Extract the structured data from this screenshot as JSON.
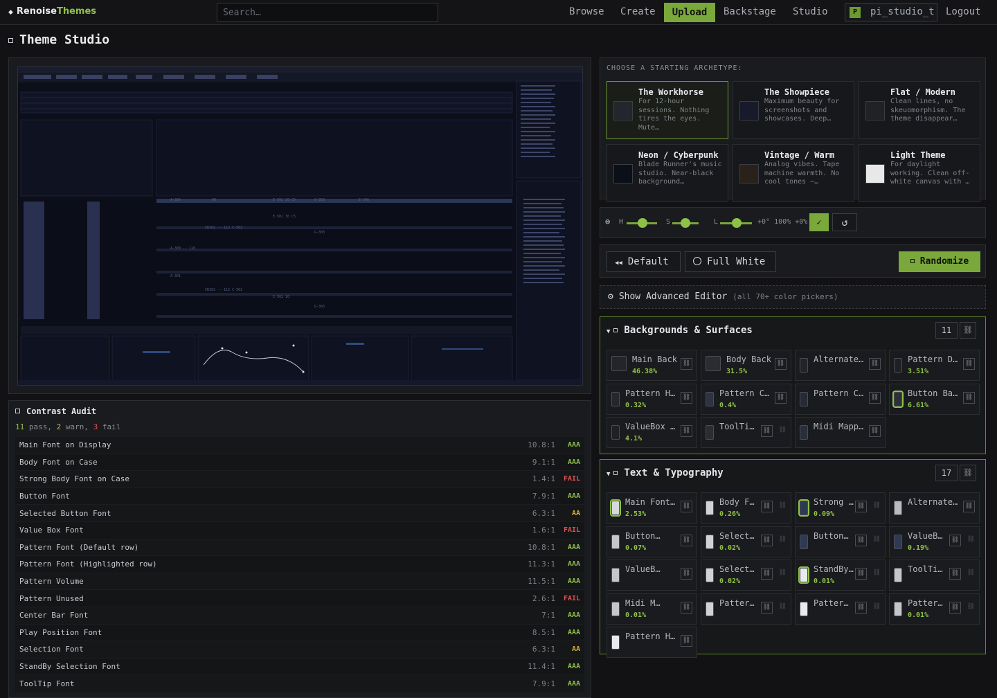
{
  "app": {
    "brand_main": "Renoise",
    "brand_accent": "Themes",
    "search_placeholder": "Search…",
    "nav": [
      "Browse",
      "Create",
      "Upload",
      "Backstage",
      "Studio"
    ],
    "active_nav": "Upload",
    "user_initial": "P",
    "user_name": "pi_studio_t",
    "logout": "Logout",
    "accent_color": "#7aa83a"
  },
  "page_title": "Theme Studio",
  "archetypes": {
    "label": "CHOOSE A STARTING ARCHETYPE:",
    "items": [
      {
        "title": "The Workhorse",
        "desc": "For 12-hour sessions. Nothing tires the eyes. Mute…",
        "swatch": "#23262c",
        "selected": true
      },
      {
        "title": "The Showpiece",
        "desc": "Maximum beauty for screenshots and showcases. Deep…",
        "swatch": "#171a2a",
        "selected": false
      },
      {
        "title": "Flat / Modern",
        "desc": "Clean lines, no skeuomorphism. The theme disappear…",
        "swatch": "#202224",
        "selected": false
      },
      {
        "title": "Neon / Cyberpunk",
        "desc": "Blade Runner's music studio. Near-black background…",
        "swatch": "#0b0f18",
        "selected": false
      },
      {
        "title": "Vintage / Warm",
        "desc": "Analog vibes. Tape machine warmth. No cool tones —…",
        "swatch": "#2a221a",
        "selected": false
      },
      {
        "title": "Light Theme",
        "desc": "For daylight working. Clean off-white canvas with …",
        "swatch": "#e8e8e8",
        "selected": false
      }
    ]
  },
  "hsl": {
    "h_label": "H",
    "s_label": "S",
    "l_label": "L",
    "readout": "+0° 100% +0%",
    "confirm": "✓",
    "reset": "↺"
  },
  "buttons": {
    "default": "Default",
    "full_white": "Full White",
    "randomize": "Randomize"
  },
  "advanced": {
    "label": "Show Advanced Editor",
    "sub": "(all 70+ color pickers)"
  },
  "audit": {
    "title": "Contrast Audit",
    "pass_count": "11",
    "pass_label": "pass,",
    "warn_count": "2",
    "warn_label": "warn,",
    "fail_count": "3",
    "fail_label": "fail",
    "rows": [
      {
        "name": "Main Font on Display",
        "ratio": "10.8:1",
        "grade": "AAA"
      },
      {
        "name": "Body Font on Case",
        "ratio": "9.1:1",
        "grade": "AAA"
      },
      {
        "name": "Strong Body Font on Case",
        "ratio": "1.4:1",
        "grade": "FAIL"
      },
      {
        "name": "Button Font",
        "ratio": "7.9:1",
        "grade": "AAA"
      },
      {
        "name": "Selected Button Font",
        "ratio": "6.3:1",
        "grade": "AA"
      },
      {
        "name": "Value Box Font",
        "ratio": "1.6:1",
        "grade": "FAIL"
      },
      {
        "name": "Pattern Font (Default row)",
        "ratio": "10.8:1",
        "grade": "AAA"
      },
      {
        "name": "Pattern Font (Highlighted row)",
        "ratio": "11.3:1",
        "grade": "AAA"
      },
      {
        "name": "Pattern Volume",
        "ratio": "11.5:1",
        "grade": "AAA"
      },
      {
        "name": "Pattern Unused",
        "ratio": "2.6:1",
        "grade": "FAIL"
      },
      {
        "name": "Center Bar Font",
        "ratio": "7:1",
        "grade": "AAA"
      },
      {
        "name": "Play Position Font",
        "ratio": "8.5:1",
        "grade": "AAA"
      },
      {
        "name": "Selection Font",
        "ratio": "6.3:1",
        "grade": "AA"
      },
      {
        "name": "StandBy Selection Font",
        "ratio": "11.4:1",
        "grade": "AAA"
      },
      {
        "name": "ToolTip Font",
        "ratio": "7.9:1",
        "grade": "AAA"
      }
    ]
  },
  "backgrounds": {
    "title": "Backgrounds & Surfaces",
    "count": "11",
    "tiles": [
      {
        "name": "Main Back",
        "pct": "46.38%",
        "color": "#23252a"
      },
      {
        "name": "Body Back",
        "pct": "31.5%",
        "color": "#2a2c30"
      },
      {
        "name": "Alternate…",
        "pct": "",
        "color": "#222429"
      },
      {
        "name": "Pattern D…",
        "pct": "3.51%",
        "color": "#1e2026"
      },
      {
        "name": "Pattern H…",
        "pct": "0.32%",
        "color": "#25272c"
      },
      {
        "name": "Pattern C…",
        "pct": "0.4%",
        "color": "#2c3440"
      },
      {
        "name": "Pattern C…",
        "pct": "",
        "color": "#262a36"
      },
      {
        "name": "Button Ba…",
        "pct": "6.61%",
        "color": "#2d3038"
      },
      {
        "name": "ValueBox …",
        "pct": "4.1%",
        "color": "#1f2125"
      },
      {
        "name": "ToolTi…",
        "pct": "",
        "color": "#2b2d31"
      },
      {
        "name": "Midi Mapp…",
        "pct": "",
        "color": "#2a2d3c"
      }
    ]
  },
  "typography": {
    "title": "Text & Typography",
    "count": "17",
    "tiles": [
      {
        "name": "Main Font…",
        "pct": "2.53%",
        "color": "#d6d8dc"
      },
      {
        "name": "Body F…",
        "pct": "0.26%",
        "color": "#d0d2d6"
      },
      {
        "name": "Strong Bo…",
        "pct": "0.09%",
        "color": "#2e3a54"
      },
      {
        "name": "Alternate…",
        "pct": "",
        "color": "#b8babf"
      },
      {
        "name": "Button…",
        "pct": "0.07%",
        "color": "#c4c6ca"
      },
      {
        "name": "Select…",
        "pct": "0.02%",
        "color": "#d0d2d6"
      },
      {
        "name": "Button…",
        "pct": "",
        "color": "#2e3a54"
      },
      {
        "name": "ValueB…",
        "pct": "0.19%",
        "color": "#2e3a54"
      },
      {
        "name": "ValueB…",
        "pct": "",
        "color": "#c4c6ca"
      },
      {
        "name": "Select…",
        "pct": "0.02%",
        "color": "#d0d2d6"
      },
      {
        "name": "StandBy S…",
        "pct": "0.01%",
        "color": "#e8eaec"
      },
      {
        "name": "ToolTi…",
        "pct": "",
        "color": "#c4c6ca"
      },
      {
        "name": "Midi M…",
        "pct": "0.01%",
        "color": "#c4c6ca"
      },
      {
        "name": "Patter…",
        "pct": "",
        "color": "#d0d2d6"
      },
      {
        "name": "Patter…",
        "pct": "",
        "color": "#e8eaec"
      },
      {
        "name": "Patter…",
        "pct": "0.01%",
        "color": "#c4c6ca"
      },
      {
        "name": "Pattern H…",
        "pct": "",
        "color": "#e8eaec"
      }
    ]
  },
  "preview_logo": "renoise"
}
